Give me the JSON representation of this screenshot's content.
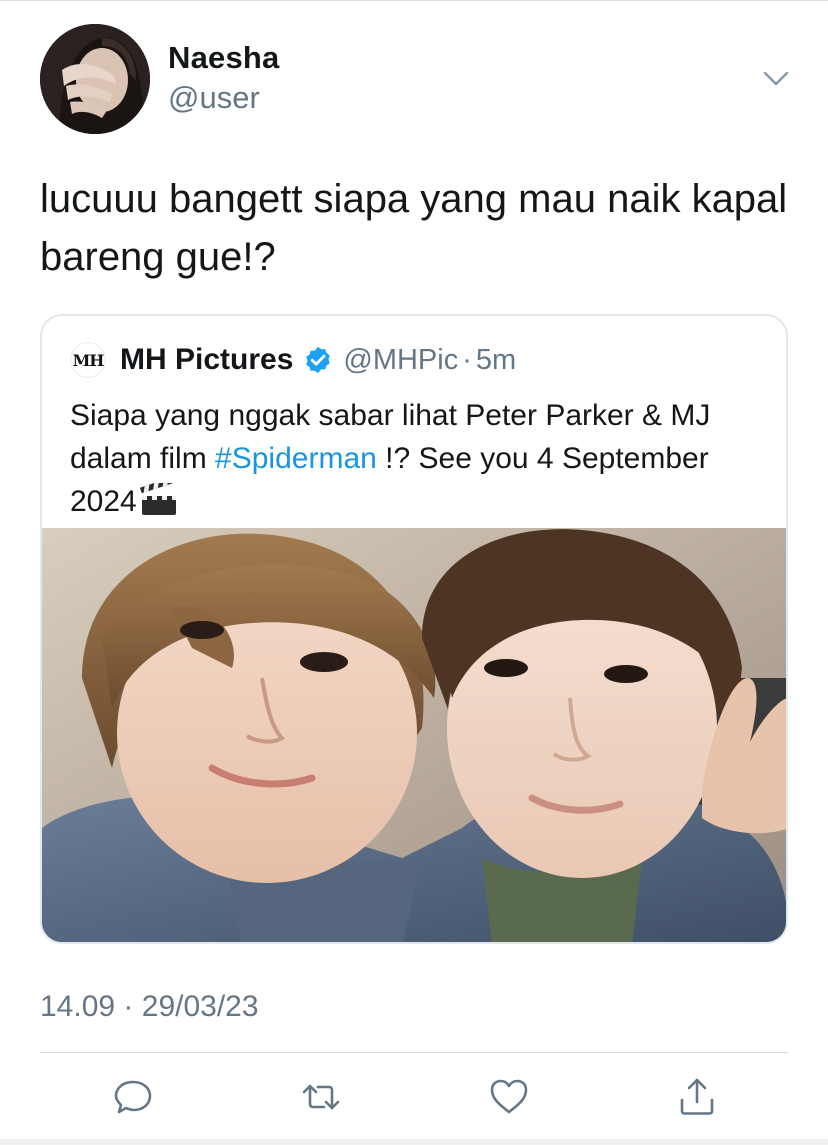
{
  "tweet": {
    "author_name": "Naesha",
    "author_handle": "@user",
    "text": "lucuuu bangett siapa yang mau naik kapal bareng gue!?",
    "time": "14.09",
    "separator": "·",
    "date": "29/03/23"
  },
  "quoted": {
    "logo_text": "MH",
    "name": "MH Pictures",
    "handle": "@MHPic",
    "separator": "·",
    "time": "5m",
    "text_before": "Siapa yang nggak sabar lihat Peter Parker & MJ dalam film ",
    "hashtag": "#Spiderman",
    "text_after": " !? See you 4 September 2024",
    "verified": true
  },
  "icons": {
    "more": "chevron-down-icon",
    "verified": "verified-badge-icon",
    "clapper": "clapper-board-icon",
    "reply": "reply-icon",
    "retweet": "retweet-icon",
    "like": "like-icon",
    "share": "share-icon"
  },
  "colors": {
    "text": "#14171a",
    "secondary": "#657786",
    "link": "#1b95e0",
    "verified": "#1da1f2",
    "border": "#e1e8ed"
  }
}
